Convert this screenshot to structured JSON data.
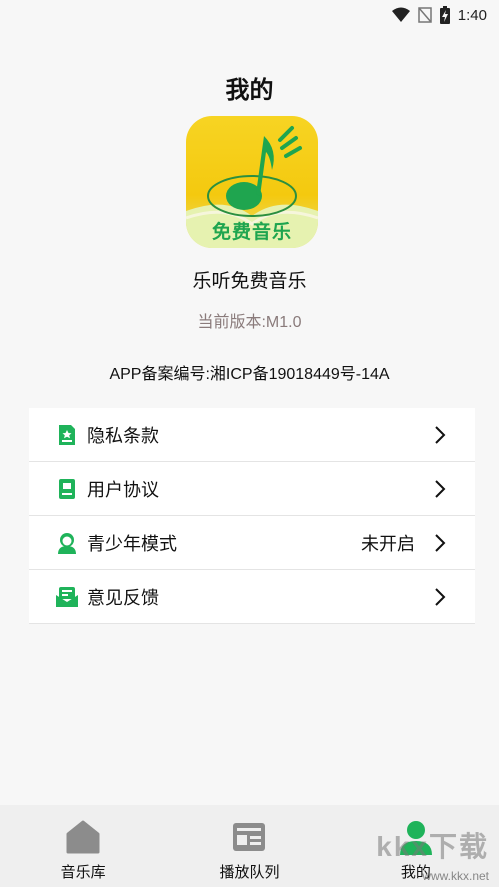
{
  "status_bar": {
    "time": "1:40",
    "icons": [
      "wifi-icon",
      "no-signal-icon",
      "battery-charging-icon"
    ]
  },
  "header": {
    "title": "我的"
  },
  "app": {
    "logo_text": "免费音乐",
    "name": "乐听免费音乐",
    "version": "当前版本:M1.0",
    "icp": "APP备案编号:湘ICP备19018449号-14A"
  },
  "menu": {
    "items": [
      {
        "label": "隐私条款",
        "icon": "privacy-doc-icon",
        "value": ""
      },
      {
        "label": "用户协议",
        "icon": "agreement-doc-icon",
        "value": ""
      },
      {
        "label": "青少年模式",
        "icon": "youth-avatar-icon",
        "value": "未开启"
      },
      {
        "label": "意见反馈",
        "icon": "feedback-mail-icon",
        "value": ""
      }
    ]
  },
  "tab_bar": {
    "tabs": [
      {
        "label": "音乐库",
        "icon": "home-icon",
        "active": false
      },
      {
        "label": "播放队列",
        "icon": "playlist-icon",
        "active": false
      },
      {
        "label": "我的",
        "icon": "user-icon",
        "active": true
      }
    ]
  },
  "watermark": {
    "text": "kkx下载",
    "url": "www.kkx.net"
  },
  "colors": {
    "accent": "#1fb35a",
    "inactive_icon": "#8c8c8c",
    "logo_yellow": "#f5cd14"
  }
}
